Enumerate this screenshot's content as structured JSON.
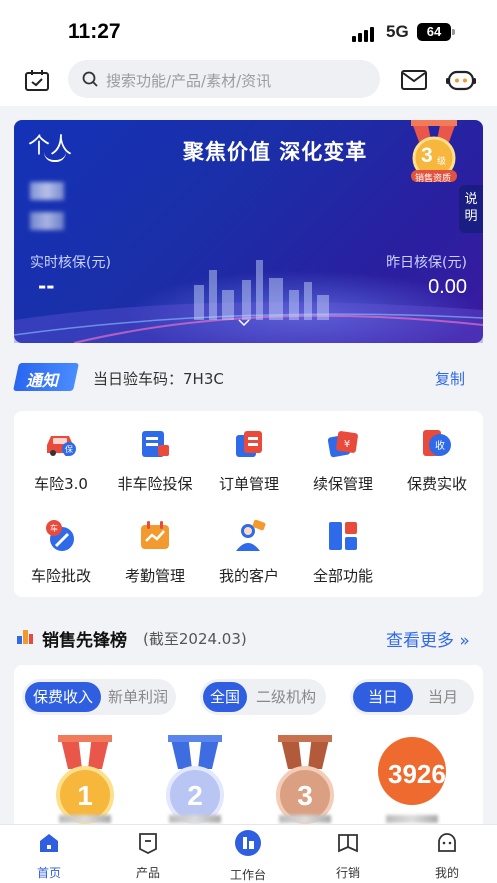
{
  "status_bar": {
    "time": "11:27",
    "network": "5G",
    "battery": "64"
  },
  "header": {
    "search_placeholder": "搜索功能/产品/素材/资讯"
  },
  "banner": {
    "tag": "个人",
    "slogan": "聚焦价值 深化变革",
    "badge_level": "3",
    "badge_level_unit": "级",
    "badge_caption": "销售资质",
    "explain": "说明",
    "left_label": "实时核保(元)",
    "left_value": "--",
    "right_label": "昨日核保(元)",
    "right_value": "0.00"
  },
  "notice": {
    "tag": "通知",
    "text": "当日验车码：7H3C",
    "copy": "复制"
  },
  "functions": [
    {
      "label": "车险3.0",
      "icon": "car-icon"
    },
    {
      "label": "非车险投保",
      "icon": "document-icon"
    },
    {
      "label": "订单管理",
      "icon": "order-icon"
    },
    {
      "label": "续保管理",
      "icon": "renew-icon"
    },
    {
      "label": "保费实收",
      "icon": "receipt-icon"
    },
    {
      "label": "车险批改",
      "icon": "edit-icon"
    },
    {
      "label": "考勤管理",
      "icon": "attendance-icon"
    },
    {
      "label": "我的客户",
      "icon": "customer-icon"
    },
    {
      "label": "全部功能",
      "icon": "all-functions-icon"
    }
  ],
  "ranking": {
    "title": "销售先锋榜",
    "subtitle": "(截至2024.03)",
    "more": "查看更多 »",
    "seg1": [
      "保费收入",
      "新单利润"
    ],
    "seg2": [
      "全国",
      "二级机构"
    ],
    "seg3": [
      "当日",
      "当月"
    ],
    "medal_labels": [
      "1",
      "2",
      "3"
    ],
    "fourth_value": "3926"
  },
  "tabbar": [
    {
      "label": "首页",
      "icon": "home-icon",
      "active": true
    },
    {
      "label": "产品",
      "icon": "product-icon",
      "active": false
    },
    {
      "label": "工作台",
      "icon": "workbench-icon",
      "active": false
    },
    {
      "label": "行销",
      "icon": "marketing-icon",
      "active": false
    },
    {
      "label": "我的",
      "icon": "profile-icon",
      "active": false
    }
  ],
  "colors": {
    "accent": "#2f5fe0",
    "banner": "#1a2fa8",
    "link": "#2f6ae8"
  }
}
